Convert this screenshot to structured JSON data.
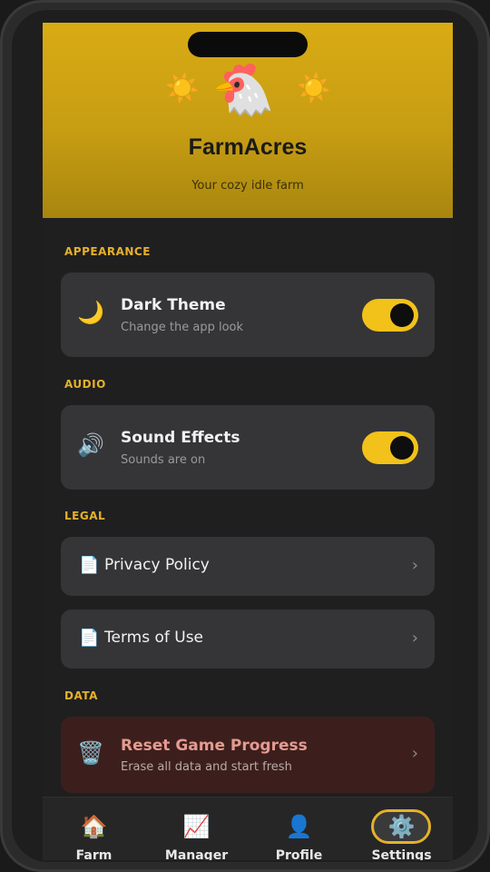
{
  "header": {
    "app_name": "FarmAcres",
    "tagline": "Your cozy idle farm",
    "mascot_icon": "🐔",
    "sun_icon": "☀️"
  },
  "sections": {
    "appearance": {
      "label": "APPEARANCE",
      "dark_theme": {
        "icon": "🌙",
        "title": "Dark Theme",
        "subtitle": "Change the app look",
        "enabled": true
      }
    },
    "audio": {
      "label": "AUDIO",
      "sound_effects": {
        "icon": "🔊",
        "title": "Sound Effects",
        "subtitle": "Sounds are on",
        "enabled": true
      }
    },
    "legal": {
      "label": "LEGAL",
      "privacy": {
        "icon": "📄",
        "title": "Privacy Policy"
      },
      "terms": {
        "icon": "📄",
        "title": "Terms of Use"
      }
    },
    "data": {
      "label": "DATA",
      "reset": {
        "icon": "🗑️",
        "title": "Reset Game Progress",
        "subtitle": "Erase all data and start fresh"
      }
    }
  },
  "chevron": "›",
  "nav": {
    "farm": {
      "icon": "🏠",
      "label": "Farm"
    },
    "manager": {
      "icon": "📈",
      "label": "Manager"
    },
    "profile": {
      "icon": "👤",
      "label": "Profile"
    },
    "settings": {
      "icon": "⚙️",
      "label": "Settings",
      "active": true
    }
  },
  "colors": {
    "accent": "#f2c21a",
    "section_label": "#e6b12a",
    "header_gold": "#d9ab14",
    "card": "#353537",
    "danger_card": "#3c1f1d"
  }
}
